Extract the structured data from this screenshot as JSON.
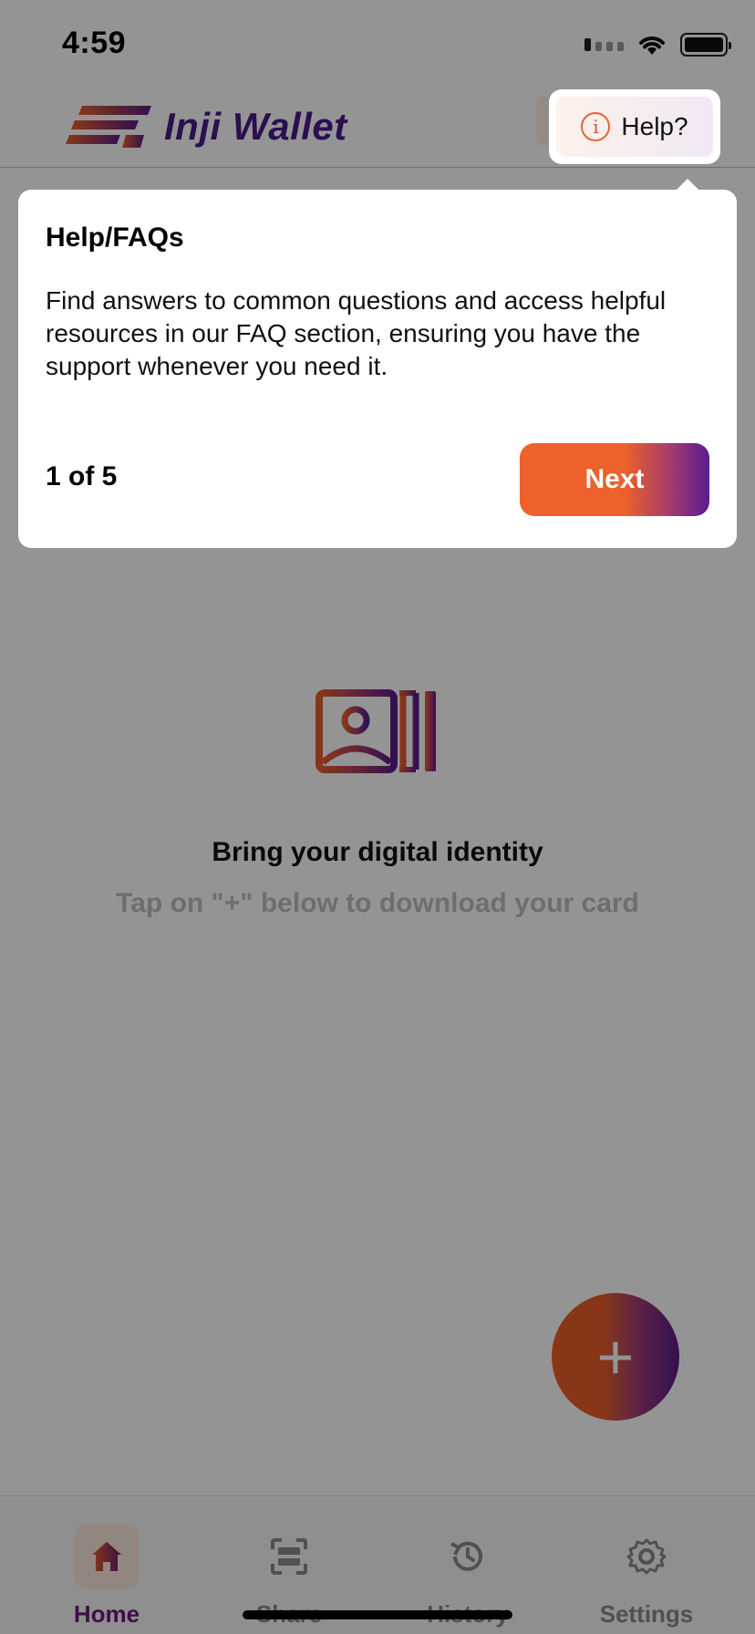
{
  "status_bar": {
    "time": "4:59"
  },
  "header": {
    "brand": "Inji Wallet",
    "help_label": "Help?"
  },
  "empty_state": {
    "title": "Bring your digital identity",
    "subtitle": "Tap on  \"+\" below to download your card"
  },
  "fab": {
    "label": "+"
  },
  "tour": {
    "title": "Help/FAQs",
    "body": "Find answers to common questions and access helpful resources in our FAQ section, ensuring you have the support whenever you need it.",
    "step": "1 of 5",
    "next_label": "Next"
  },
  "nav": {
    "items": [
      {
        "label": "Home",
        "icon": "home-icon",
        "active": true
      },
      {
        "label": "Share",
        "icon": "scan-icon",
        "active": false
      },
      {
        "label": "History",
        "icon": "history-icon",
        "active": false
      },
      {
        "label": "Settings",
        "icon": "gear-icon",
        "active": false
      }
    ]
  },
  "colors": {
    "brand_orange": "#e9602a",
    "brand_purple": "#5a1c8a",
    "nav_active": "#6b1a7a"
  }
}
